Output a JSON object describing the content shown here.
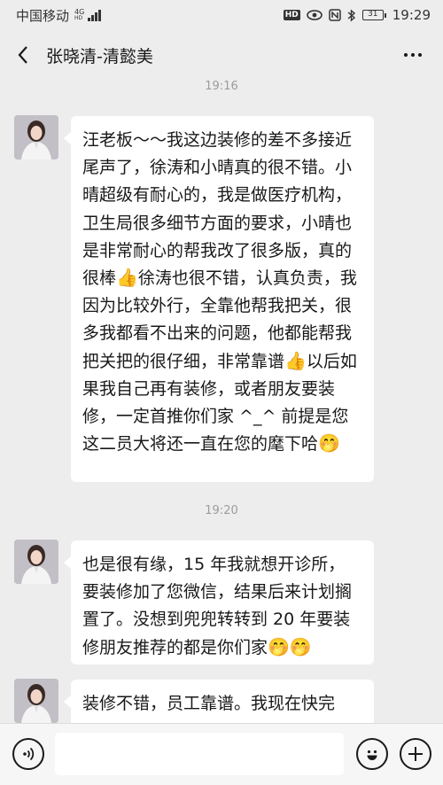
{
  "status_bar": {
    "carrier": "中国移动",
    "net_top": "4G",
    "net_bottom": "HD",
    "hd": "HD",
    "battery": "31",
    "time": "19:29"
  },
  "header": {
    "title": "张晓清-清懿美"
  },
  "messages": [
    {
      "time": "19:16",
      "parts": [
        "汪老板～～我这边装修的差不多接近尾声了，徐涛和小晴真的很不错。小晴超级有耐心的，我是做医疗机构，卫生局很多细节方面的要求，小晴也是非常耐心的帮我改了很多版，真的很棒",
        "👍",
        "徐涛也很不错，认真负责，我因为比较外行，全靠他帮我把关，很多我都看不出来的问题，他都能帮我把关把的很仔细，非常靠谱",
        "👍",
        "以后如果我自己再有装修，或者朋友要装修，一定首推你们家 ^_^ 前提是您这二员大将还一直在您的麾下哈",
        "🤭"
      ]
    },
    {
      "time": "19:20",
      "parts": [
        "也是很有缘，15 年我就想开诊所，要装修加了您微信，结果后来计划搁置了。没想到兜兜转转到 20 年要装修朋友推荐的都是你们家",
        "🤭🤭"
      ]
    },
    {
      "parts": [
        "装修不错，员工靠谱。我现在快完"
      ]
    }
  ],
  "input_bar": {
    "value": ""
  },
  "colors": {
    "background": "#ededed",
    "bubble": "#ffffff",
    "timestamp": "#9b9b9b"
  }
}
